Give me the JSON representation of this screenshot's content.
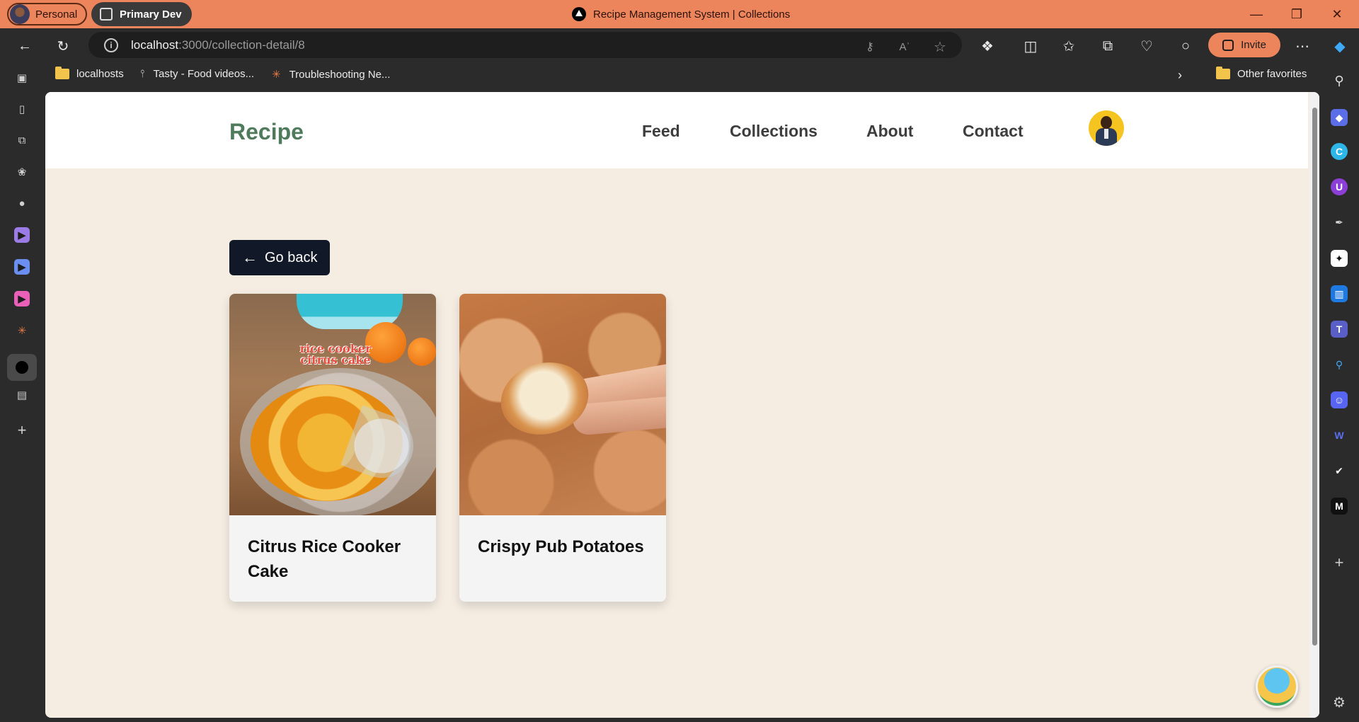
{
  "browser": {
    "profile_label": "Personal",
    "workspace_label": "Primary Dev",
    "window_title": "Recipe Management System | Collections",
    "url_host": "localhost",
    "url_path": ":3000/collection-detail/8",
    "invite_label": "Invite",
    "favorites": [
      {
        "label": "localhosts",
        "icon": "folder-icon"
      },
      {
        "label": "Tasty - Food videos...",
        "icon": "fork-icon"
      },
      {
        "label": "Troubleshooting Ne...",
        "icon": "burst-icon"
      }
    ],
    "other_favorites_label": "Other favorites"
  },
  "site": {
    "brand": "Recipe",
    "nav": [
      "Feed",
      "Collections",
      "About",
      "Contact"
    ],
    "brand_color": "#4f7a5c",
    "page_background": "#f5ede2"
  },
  "main": {
    "go_back_label": "Go back",
    "recipes": [
      {
        "title": "Citrus Rice Cooker Cake",
        "image_caption": "rice cooker citrus cake"
      },
      {
        "title": "Crispy Pub Potatoes"
      }
    ]
  },
  "colors": {
    "titlebar": "#ec845c",
    "button_dark": "#111827",
    "invite": "#ec845c"
  }
}
